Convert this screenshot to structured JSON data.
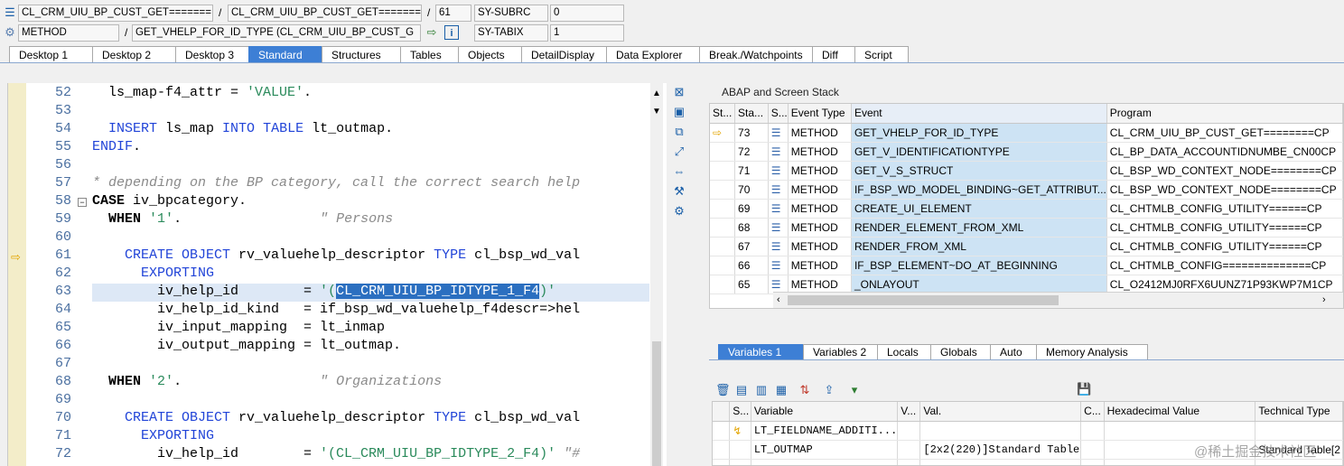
{
  "header": {
    "row1": {
      "program": "CL_CRM_UIU_BP_CUST_GET=======",
      "include": "CL_CRM_UIU_BP_CUST_GET=======",
      "line": "61",
      "sysvar": "SY-SUBRC",
      "sysval": "0"
    },
    "row2": {
      "type": "METHOD",
      "name": "GET_VHELP_FOR_ID_TYPE (CL_CRM_UIU_BP_CUST_G",
      "sysvar": "SY-TABIX",
      "sysval": "1"
    },
    "separator": "/"
  },
  "tabs": [
    "Desktop 1",
    "Desktop 2",
    "Desktop 3",
    "Standard",
    "Structures",
    "Tables",
    "Objects",
    "DetailDisplay",
    "Data Explorer",
    "Break./Watchpoints",
    "Diff",
    "Script"
  ],
  "active_tab": "Standard",
  "code": {
    "line_numbers": [
      "52",
      "53",
      "54",
      "55",
      "56",
      "57",
      "58",
      "59",
      "60",
      "61",
      "62",
      "63",
      "64",
      "65",
      "66",
      "67",
      "68",
      "69",
      "70",
      "71",
      "72"
    ]
  },
  "stack": {
    "title": "ABAP and Screen Stack",
    "columns": [
      "St...",
      "Sta...",
      "S...",
      "Event Type",
      "Event",
      "Program"
    ],
    "rows": [
      {
        "level": "73",
        "type": "METHOD",
        "event": "GET_VHELP_FOR_ID_TYPE",
        "program": "CL_CRM_UIU_BP_CUST_GET========CP"
      },
      {
        "level": "72",
        "type": "METHOD",
        "event": "GET_V_IDENTIFICATIONTYPE",
        "program": "CL_BP_DATA_ACCOUNTIDNUMBE_CN00CP"
      },
      {
        "level": "71",
        "type": "METHOD",
        "event": "GET_V_S_STRUCT",
        "program": "CL_BSP_WD_CONTEXT_NODE========CP"
      },
      {
        "level": "70",
        "type": "METHOD",
        "event": "IF_BSP_WD_MODEL_BINDING~GET_ATTRIBUT...",
        "program": "CL_BSP_WD_CONTEXT_NODE========CP"
      },
      {
        "level": "69",
        "type": "METHOD",
        "event": "CREATE_UI_ELEMENT",
        "program": "CL_CHTMLB_CONFIG_UTILITY======CP"
      },
      {
        "level": "68",
        "type": "METHOD",
        "event": "RENDER_ELEMENT_FROM_XML",
        "program": "CL_CHTMLB_CONFIG_UTILITY======CP"
      },
      {
        "level": "67",
        "type": "METHOD",
        "event": "RENDER_FROM_XML",
        "program": "CL_CHTMLB_CONFIG_UTILITY======CP"
      },
      {
        "level": "66",
        "type": "METHOD",
        "event": "IF_BSP_ELEMENT~DO_AT_BEGINNING",
        "program": "CL_CHTMLB_CONFIG==============CP"
      },
      {
        "level": "65",
        "type": "METHOD",
        "event": "_ONLAYOUT",
        "program": "CL_O2412MJ0RFX6UUNZ71P93KWP7M1CP"
      }
    ]
  },
  "var_tabs": [
    "Variables 1",
    "Variables 2",
    "Locals",
    "Globals",
    "Auto",
    "Memory Analysis"
  ],
  "variables": {
    "columns": [
      "S...",
      "Variable",
      "V...",
      "Val.",
      "C...",
      "Hexadecimal Value",
      "Technical Type"
    ],
    "rows": [
      {
        "variable": "LT_FIELDNAME_ADDITI...",
        "value": "",
        "tech": ""
      },
      {
        "variable": "LT_OUTMAP",
        "value": "[2x2(220)]Standard Table",
        "tech": "Standard Table[2"
      }
    ]
  },
  "watermark": "@稀土掘金技术社区"
}
